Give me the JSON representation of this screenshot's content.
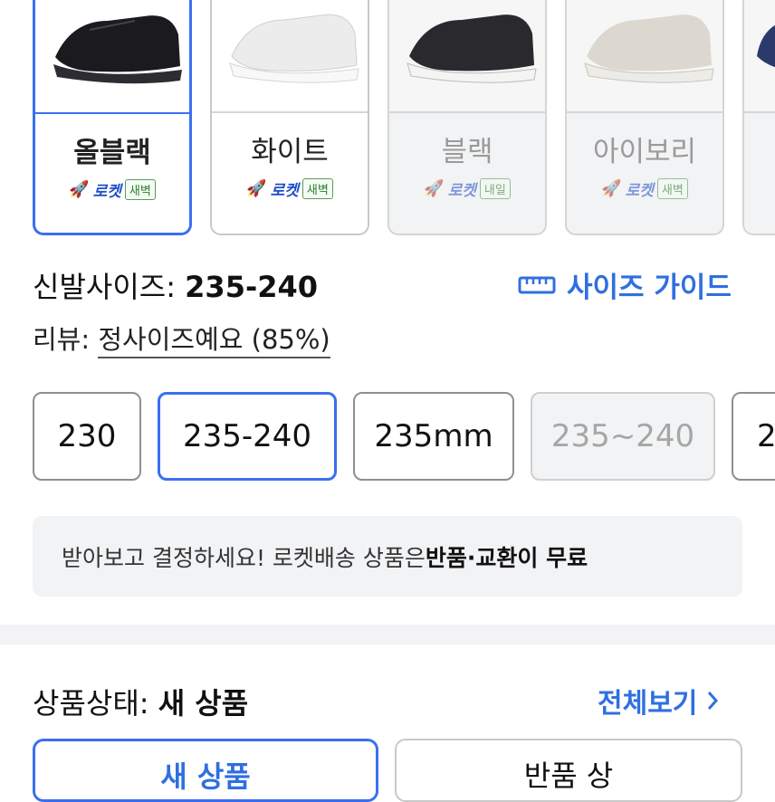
{
  "colors": {
    "accent": "#3a6ff0",
    "link": "#2f6fe0",
    "border": "#c8c8c8",
    "soldout_bg": "#f2f3f5"
  },
  "color_options": [
    {
      "name": "올블랙",
      "rocket": "로켓",
      "tag": "새벽",
      "state": "selected",
      "shoe_color": "#1b1b1f"
    },
    {
      "name": "화이트",
      "rocket": "로켓",
      "tag": "새벽",
      "state": "available",
      "shoe_color": "#f0f0f0"
    },
    {
      "name": "블랙",
      "rocket": "로켓",
      "tag": "내일",
      "state": "soldout",
      "shoe_color": "#2a2a2e"
    },
    {
      "name": "아이보리",
      "rocket": "로켓",
      "tag": "새벽",
      "state": "soldout",
      "shoe_color": "#ddd8cf"
    }
  ],
  "size_section": {
    "label": "신발사이즈:",
    "selected_value": "235-240",
    "guide_label": "사이즈 가이드",
    "review_label": "리뷰:",
    "review_value": "정사이즈예요 (85%)"
  },
  "sizes": [
    {
      "label": "230",
      "state": "available"
    },
    {
      "label": "235-240",
      "state": "selected"
    },
    {
      "label": "235mm",
      "state": "available"
    },
    {
      "label": "235~240",
      "state": "soldout"
    },
    {
      "label": "2",
      "state": "available"
    }
  ],
  "notice": {
    "text": "받아보고 결정하세요! 로켓배송 상품은 ",
    "emphasis": "반품·교환이 무료"
  },
  "condition": {
    "label": "상품상태:",
    "value": "새 상품",
    "view_all": "전체보기",
    "options": [
      {
        "label": "새 상품",
        "state": "selected"
      },
      {
        "label": "반품 상",
        "state": "available"
      }
    ]
  }
}
